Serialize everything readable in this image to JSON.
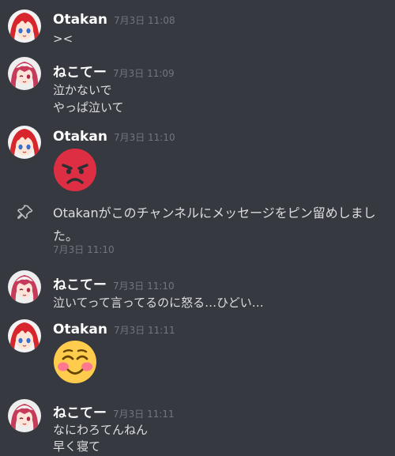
{
  "messages": [
    {
      "author": "Otakan",
      "timestamp": "7月3日 11:08",
      "lines": [
        "><"
      ]
    },
    {
      "author": "ねこてー",
      "timestamp": "7月3日 11:09",
      "lines": [
        "泣かないで",
        "やっぱ泣いて"
      ]
    },
    {
      "author": "Otakan",
      "timestamp": "7月3日 11:10",
      "emoji": "pouting-face"
    },
    {
      "author": "ねこてー",
      "timestamp": "7月3日 11:10",
      "lines": [
        "泣いてって言ってるのに怒る…ひどい…"
      ]
    },
    {
      "author": "Otakan",
      "timestamp": "7月3日 11:11",
      "emoji": "smiling-face"
    },
    {
      "author": "ねこてー",
      "timestamp": "7月3日 11:11",
      "lines": [
        "なにわろてんねん",
        "早く寝て"
      ]
    }
  ],
  "system_pin": {
    "text": "Otakanがこのチャンネルにメッセージをピン留めしました。",
    "timestamp": "7月3日 11:10",
    "icon": "pin-icon"
  },
  "colors": {
    "background": "#36393f",
    "author": "#ffffff",
    "timestamp": "#72767d",
    "text": "#dcddde"
  }
}
